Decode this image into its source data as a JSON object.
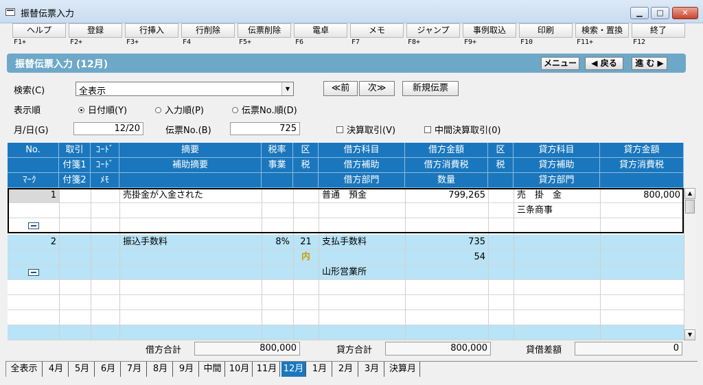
{
  "window": {
    "title": "振替伝票入力"
  },
  "toolbar": {
    "items": [
      {
        "label": "ヘルプ",
        "key": "F1+"
      },
      {
        "label": "登録",
        "key": "F2+"
      },
      {
        "label": "行挿入",
        "key": "F3+"
      },
      {
        "label": "行削除",
        "key": "F4"
      },
      {
        "label": "伝票削除",
        "key": "F5+"
      },
      {
        "label": "電卓",
        "key": "F6"
      },
      {
        "label": "メモ",
        "key": "F7"
      },
      {
        "label": "ジャンプ",
        "key": "F8+"
      },
      {
        "label": "事例取込",
        "key": "F9+"
      },
      {
        "label": "印刷",
        "key": "F10"
      },
      {
        "label": "検索・置換",
        "key": "F11+"
      },
      {
        "label": "終了",
        "key": "F12"
      }
    ]
  },
  "header": {
    "title": "振替伝票入力 (12月)",
    "menu": "メニュー",
    "back": "◀ 戻る",
    "forward": "進 む ▶"
  },
  "search": {
    "label": "検索(C)",
    "value": "全表示",
    "prev": "≪前",
    "next": "次≫",
    "new": "新規伝票"
  },
  "order": {
    "label": "表示順",
    "options": [
      "日付順(Y)",
      "入力順(P)",
      "伝票No.順(D)"
    ],
    "selected": 0
  },
  "date": {
    "label": "月/日(G)",
    "value": "12/20"
  },
  "slip": {
    "label": "伝票No.(B)",
    "value": "725"
  },
  "checks": {
    "settlement": "決算取引(V)",
    "interim": "中間決算取引(0)"
  },
  "columns": {
    "row1": [
      "No.",
      "取引",
      "ｺｰﾄﾞ",
      "摘要",
      "税率",
      "区",
      "借方科目",
      "借方金額",
      "区",
      "貸方科目",
      "貸方金額"
    ],
    "row2": [
      "付箋1",
      "ｺｰﾄﾞ",
      "補助摘要",
      "事業",
      "税",
      "借方補助",
      "借方消費税",
      "税",
      "貸方補助",
      "貸方消費税"
    ],
    "row3": [
      "ﾏｰｸ",
      "付箋2",
      "ﾒﾓ",
      "借方部門",
      "数量",
      "貸方部門"
    ]
  },
  "entries": [
    {
      "no": "1",
      "summary": "売掛金が入金された",
      "debit_account": "普通　預金",
      "debit_amount": "799,265",
      "credit_account": "売　掛　金",
      "credit_sub": "三条商事",
      "credit_amount": "800,000"
    },
    {
      "no": "2",
      "summary": "振込手数料",
      "tax_rate": "8%",
      "tax_code": "21",
      "tax_type": "内",
      "debit_account": "支払手数料",
      "debit_amount": "735",
      "debit_tax": "54",
      "debit_dept": "山形営業所"
    }
  ],
  "totals": {
    "debit_label": "借方合計",
    "debit": "800,000",
    "credit_label": "貸方合計",
    "credit": "800,000",
    "diff_label": "貸借差額",
    "diff": "0"
  },
  "tabs": {
    "items": [
      "全表示",
      "4月",
      "5月",
      "6月",
      "7月",
      "8月",
      "9月",
      "中間",
      "10月",
      "11月",
      "12月",
      "1月",
      "2月",
      "3月",
      "決算月"
    ],
    "selected": 10
  }
}
